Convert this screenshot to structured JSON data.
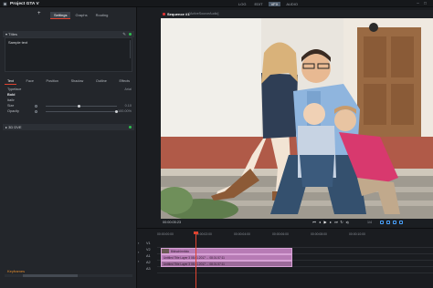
{
  "app": {
    "project_title": "Project GTA V"
  },
  "modes": [
    "LOG",
    "EDIT",
    "VFX",
    "AUDIO"
  ],
  "active_mode": "VFX",
  "left_panel": {
    "tabs": [
      "Settings",
      "Graphs",
      "Routing"
    ],
    "active_tab": "Settings",
    "section_titles": "TItles",
    "text_value": "Sample text",
    "style_tabs": [
      "Text",
      "Face",
      "Position",
      "Shadow",
      "Outline",
      "Effects"
    ],
    "active_style_tab": "Text",
    "typeface_label": "Typeface",
    "typeface_value": "Arial",
    "bold_label": "Bold",
    "italic_label": "Italic",
    "size_label": "Size",
    "size_value": "0.10",
    "opacity_label": "Opacity",
    "opacity_value": "100.00%",
    "section_3d": "3D DVE",
    "status_label": "Keyframes"
  },
  "viewer": {
    "sequence_name": "Sequence #1",
    "sequence_sub": "[ActiveSourceAudio]",
    "timecode": "00:00:05:23",
    "fps": "1/4"
  },
  "timeline": {
    "ruler": [
      "00:00:00:00",
      "00:00:02:00",
      "00:00:04:00",
      "00:00:06:00",
      "00:00:08:00",
      "00:00:10:00"
    ],
    "tracks": [
      "V1",
      "V2",
      "A1",
      "A2",
      "A3"
    ],
    "clips": {
      "video_top": "Bildschirmfoto",
      "video_main": "Untitled Title Layer 3 08.01.2017 ... 08.01.57:11",
      "audio_main": "Untitled Title Layer 3 08.01.2017 ... 08.01.57:11"
    }
  },
  "colors": {
    "accent": "#e0432f",
    "green": "#2fbf4f",
    "clip": "#b77bb5",
    "status": "#e28a2b"
  }
}
